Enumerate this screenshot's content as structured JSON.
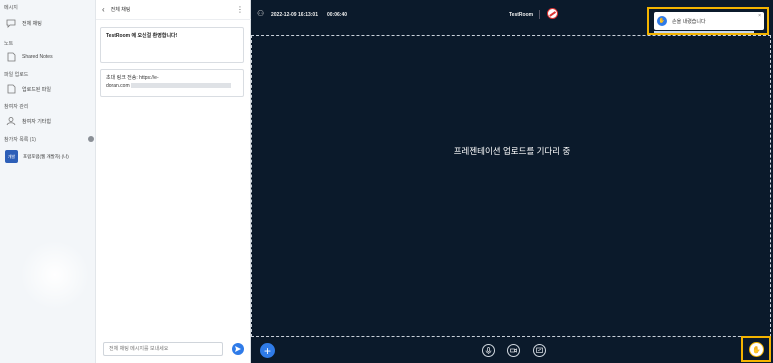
{
  "sidebar": {
    "sections": {
      "message": "메시지",
      "note": "노트",
      "file_upload": "파일 업로드",
      "participant_mgmt": "참여자 관리",
      "participant_list": "참가자 목록 (1)"
    },
    "items": {
      "all_chat": "전체 채팅",
      "shared_notes": "Shared Notes",
      "upload_file": "업로드된 파일",
      "participant_info": "참여자 기타힘"
    },
    "user": {
      "avatar_text": "개발",
      "name": "포럼포럼(웹 개발자) (나)"
    }
  },
  "chat": {
    "title": "전체 채팅",
    "welcome": "TestRoom 에 오신걸 환영합니다!",
    "invite_line1": "초대 링크 전송: https://e-",
    "invite_line2": "doran.com",
    "input_placeholder": "전체 채팅 메시지를 보내세요"
  },
  "topbar": {
    "date": "2022-12-09 16:13:01",
    "elapsed": "00:06:40",
    "room": "TestRoom"
  },
  "stage": {
    "waiting_text": "프레젠테이션 업로드를 기다리 중"
  },
  "notification": {
    "text": "손을 내렸습니다",
    "close": "×"
  },
  "icons": {
    "back": "chevron-left-icon",
    "more": "more-vertical-icon",
    "send": "send-icon",
    "plus": "plus-icon",
    "mic": "mic-icon",
    "camera": "camera-icon",
    "screen": "screen-share-icon",
    "hand": "hand-raise-icon"
  },
  "colors": {
    "accent": "#2f7be8",
    "stage_bg": "#0b1a2b",
    "highlight": "#f4b400"
  }
}
